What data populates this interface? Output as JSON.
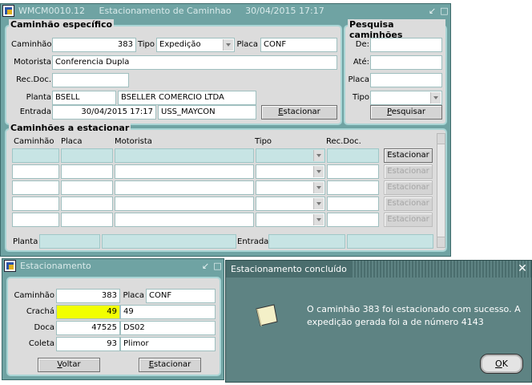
{
  "main": {
    "title": "WMCM0010.12     Estacionamento de Caminhao     30/04/2015 17:17",
    "specific": {
      "title": "Caminhão específico",
      "caminhao_label": "Caminhão",
      "caminhao": "383",
      "tipo_label": "Tipo",
      "tipo": "Expedição",
      "placa_label": "Placa",
      "placa": "CONF",
      "motorista_label": "Motorista",
      "motorista": "Conferencia Dupla",
      "recdoc_label": "Rec.Doc.",
      "recdoc": "",
      "planta_label": "Planta",
      "planta_code": "BSELL",
      "planta_name": "BSELLER COMERCIO LTDA",
      "entrada_label": "Entrada",
      "entrada_date": "30/04/2015 17:17",
      "entrada_user": "USS_MAYCON",
      "estacionar_pre": "E",
      "estacionar_rest": "stacionar"
    },
    "search": {
      "title": "Pesquisa caminhões",
      "de_label": "De:",
      "ate_label": "Até:",
      "placa_label": "Placa",
      "tipo_label": "Tipo",
      "btn_pre": "P",
      "btn_rest": "esquisar"
    },
    "park": {
      "title": "Caminhões a estacionar",
      "col_caminhao": "Caminhão",
      "col_placa": "Placa",
      "col_motorista": "Motorista",
      "col_tipo": "Tipo",
      "col_recdoc": "Rec.Doc.",
      "row_button": "Estacionar",
      "planta_label": "Planta",
      "entrada_label": "Entrada"
    }
  },
  "est": {
    "title": "Estacionamento",
    "caminhao_label": "Caminhão",
    "caminhao": "383",
    "placa_label": "Placa",
    "placa": "CONF",
    "cracha_label": "Crachá",
    "cracha": "49",
    "cracha_desc": "49",
    "doca_label": "Doca",
    "doca": "47525",
    "doca_desc": "DS02",
    "coleta_label": "Coleta",
    "coleta": "93",
    "coleta_desc": "Plimor",
    "voltar_pre": "V",
    "voltar_rest": "oltar",
    "estacionar_pre": "E",
    "estacionar_rest": "stacionar"
  },
  "dialog": {
    "title": "Estacionamento concluído",
    "message": "O caminhão 383 foi estacionado com sucesso. A expedição gerada foi a de número 4143",
    "ok_pre": "O",
    "ok_rest": "K"
  }
}
